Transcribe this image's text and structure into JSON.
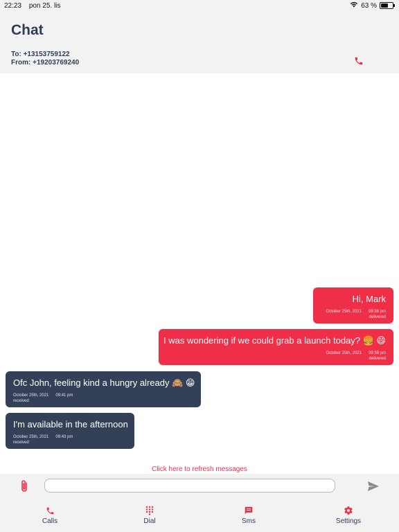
{
  "status_bar": {
    "time": "22:23",
    "date": "pon 25. lis",
    "battery": "63 %",
    "battery_level": 0.63
  },
  "header": {
    "title": "Chat",
    "to_line": "To: +13153759122",
    "from_line": "From: +19203769240"
  },
  "messages": [
    {
      "direction": "sent",
      "text": "Hi, Mark",
      "date": "October 25th, 2021",
      "time": "09:38 pm",
      "status": "delivered"
    },
    {
      "direction": "sent",
      "text": "I was wondering if we could grab a launch today? 🍔 😄",
      "date": "October 25th, 2021",
      "time": "09:39 pm",
      "status": "delivered"
    },
    {
      "direction": "received",
      "text": "Ofc John, feeling kind a hungry already 🙈 😁",
      "date": "October 25th, 2021",
      "time": "09:41 pm",
      "status": "received"
    },
    {
      "direction": "received",
      "text": "I'm available in the afternoon",
      "date": "October 25th, 2021",
      "time": "09:43 pm",
      "status": "received"
    }
  ],
  "refresh": {
    "label": "Click here to refresh messages"
  },
  "composer": {
    "placeholder": "",
    "value": ""
  },
  "nav": {
    "calls": "Calls",
    "dial": "Dial",
    "sms": "Sms",
    "settings": "Settings"
  },
  "colors": {
    "accent": "#ef2e48",
    "received_bubble": "#344058",
    "header_text": "#2f3c56",
    "bar_background": "#f2f2f2"
  },
  "icons": {
    "call": "phone-icon",
    "attach": "paperclip-icon",
    "send": "send-icon",
    "calls_tab": "phone-icon",
    "dial_tab": "dialpad-icon",
    "sms_tab": "message-icon",
    "settings_tab": "gear-icon"
  }
}
